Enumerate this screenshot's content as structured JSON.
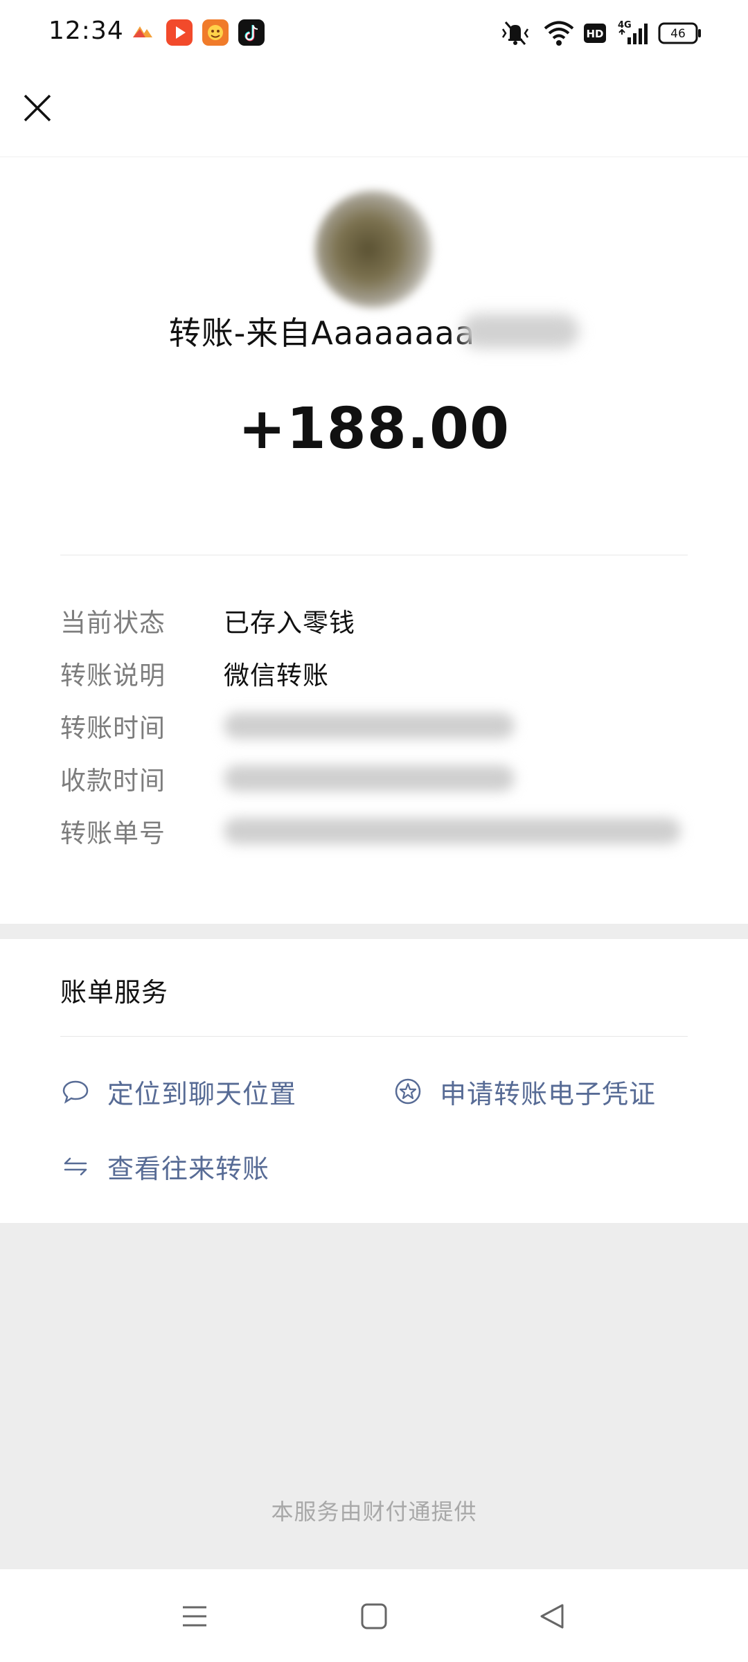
{
  "status_bar": {
    "time": "12:34",
    "network": "4G",
    "hd": "HD",
    "battery": "46",
    "app_icons": [
      "photos-app-icon",
      "video-app-icon",
      "game-app-icon",
      "tiktok-app-icon"
    ],
    "system_icons": [
      "vibrate-mute-icon",
      "wifi-icon",
      "hd-icon",
      "signal-icon",
      "battery-icon"
    ]
  },
  "header": {
    "close_icon": "close-icon"
  },
  "transfer": {
    "sender_title": "转账-来自Aaaaaaaa",
    "amount": "+188.00"
  },
  "details": [
    {
      "label": "当前状态",
      "value": "已存入零钱"
    },
    {
      "label": "转账说明",
      "value": "微信转账"
    },
    {
      "label": "转账时间",
      "value": ""
    },
    {
      "label": "收款时间",
      "value": ""
    },
    {
      "label": "转账单号",
      "value": ""
    }
  ],
  "services": {
    "title": "账单服务",
    "links": [
      {
        "label": "定位到聊天位置",
        "icon": "chat-bubble-icon"
      },
      {
        "label": "申请转账电子凭证",
        "icon": "star-badge-icon"
      },
      {
        "label": "查看往来转账",
        "icon": "transfer-arrows-icon"
      }
    ]
  },
  "footer": {
    "provider_text": "本服务由财付通提供"
  },
  "colors": {
    "link": "#576b95",
    "label": "#7d7d7d",
    "page_background": "#ededed"
  }
}
